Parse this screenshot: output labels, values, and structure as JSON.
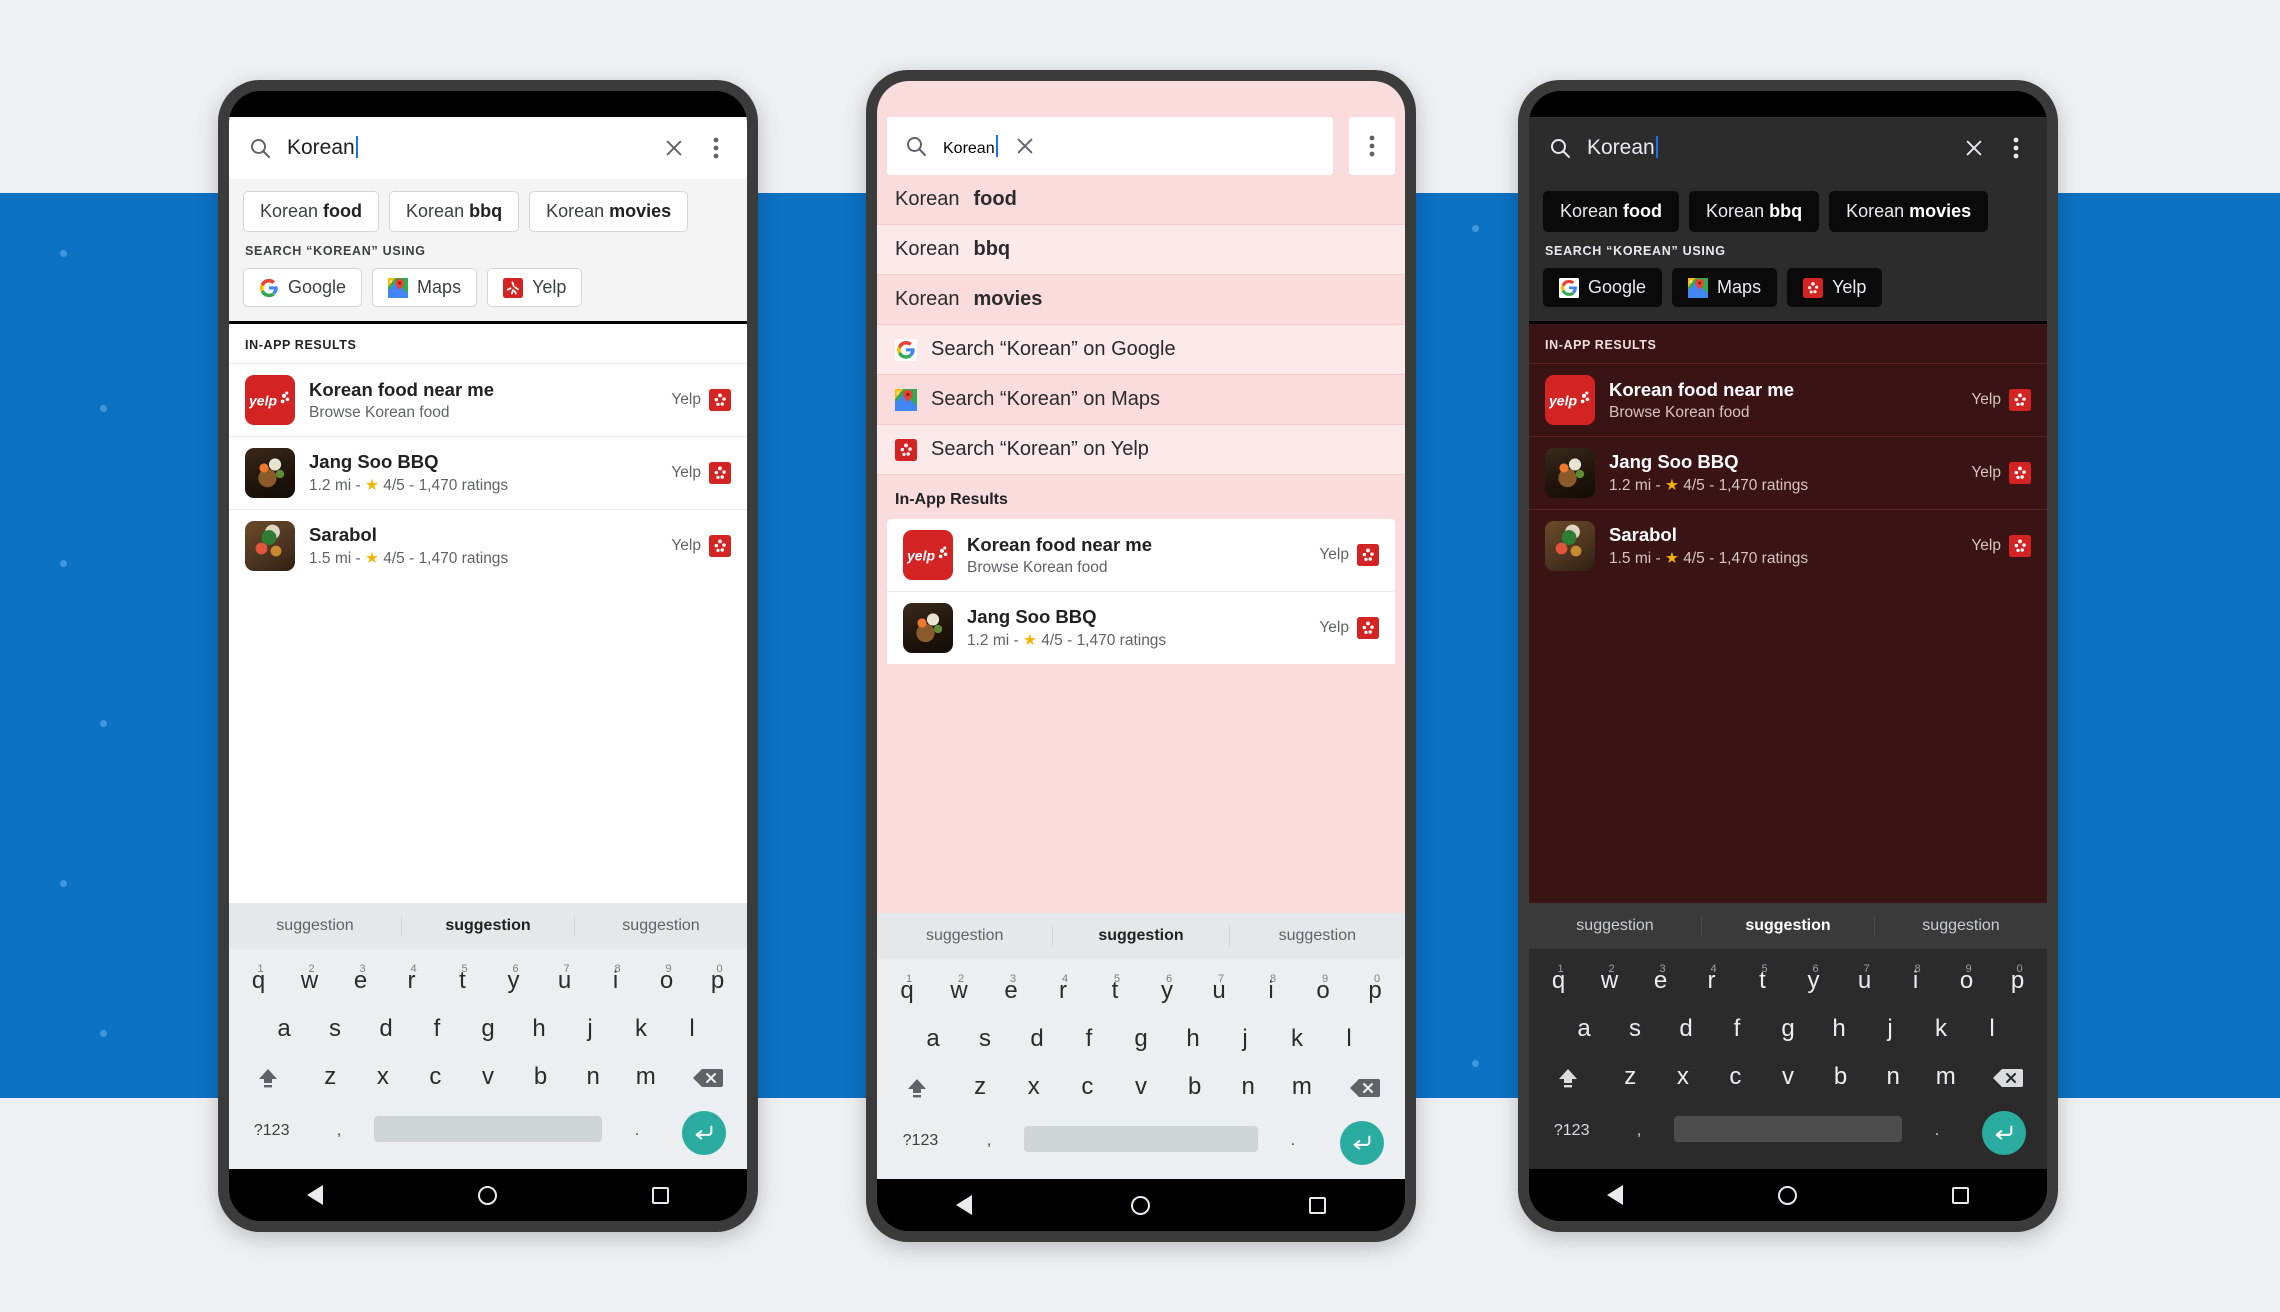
{
  "search": {
    "query": "Korean",
    "search_icon": "search-icon",
    "clear_icon": "close-icon",
    "overflow_icon": "kebab-menu-icon"
  },
  "chips": [
    {
      "prefix": "Korean ",
      "bold": "food"
    },
    {
      "prefix": "Korean ",
      "bold": "bbq"
    },
    {
      "prefix": "Korean ",
      "bold": "movies"
    }
  ],
  "engines_label": "SEARCH “KOREAN” USING",
  "engines": [
    {
      "label": "Google",
      "icon": "google-icon"
    },
    {
      "label": "Maps",
      "icon": "google-maps-icon"
    },
    {
      "label": "Yelp",
      "icon": "yelp-icon"
    }
  ],
  "results_label_caps": "IN-APP RESULTS",
  "results_label_title": "In-App Results",
  "results": [
    {
      "title": "Korean food near me",
      "subtitle": "Browse Korean food",
      "source": "Yelp",
      "thumb": "yelp-logo-tile",
      "has_rating": false
    },
    {
      "title": "Jang Soo BBQ",
      "distance": "1.2 mi",
      "separator": " - ",
      "star": "★",
      "rating": "4/5",
      "ratings_count": "1,470 ratings",
      "source": "Yelp",
      "thumb": "food-photo-bbq",
      "has_rating": true
    },
    {
      "title": "Sarabol",
      "distance": "1.5 mi",
      "separator": " - ",
      "star": "★",
      "rating": "4/5",
      "ratings_count": "1,470 ratings",
      "source": "Yelp",
      "thumb": "food-photo-sarabol",
      "has_rating": true
    }
  ],
  "pink_suggestions": [
    {
      "prefix": "Korean ",
      "bold": "food",
      "icon": null
    },
    {
      "prefix": "Korean ",
      "bold": "bbq",
      "icon": null
    },
    {
      "prefix": "Korean ",
      "bold": "movies",
      "icon": null
    },
    {
      "prefix": "Search “Korean” on Google",
      "bold": "",
      "icon": "google-icon"
    },
    {
      "prefix": "Search “Korean” on Maps",
      "bold": "",
      "icon": "google-maps-icon"
    },
    {
      "prefix": "Search “Korean” on Yelp",
      "bold": "",
      "icon": "yelp-icon"
    }
  ],
  "keyboard": {
    "suggestions": [
      "suggestion",
      "suggestion",
      "suggestion"
    ],
    "selected_index": 1,
    "row1": [
      {
        "k": "q",
        "n": "1"
      },
      {
        "k": "w",
        "n": "2"
      },
      {
        "k": "e",
        "n": "3"
      },
      {
        "k": "r",
        "n": "4"
      },
      {
        "k": "t",
        "n": "5"
      },
      {
        "k": "y",
        "n": "6"
      },
      {
        "k": "u",
        "n": "7"
      },
      {
        "k": "i",
        "n": "8"
      },
      {
        "k": "o",
        "n": "9"
      },
      {
        "k": "p",
        "n": "0"
      }
    ],
    "row2": [
      "a",
      "s",
      "d",
      "f",
      "g",
      "h",
      "j",
      "k",
      "l"
    ],
    "row3": [
      "z",
      "x",
      "c",
      "v",
      "b",
      "n",
      "m"
    ],
    "shift_icon": "shift-up-icon",
    "backspace_icon": "backspace-icon",
    "symbols_key": "?123",
    "comma_key": ",",
    "period_key": ".",
    "enter_icon": "enter-key-icon",
    "enter_color": "#2aada0"
  },
  "navbar": {
    "back_icon": "back-triangle-icon",
    "home_icon": "home-circle-icon",
    "recents_icon": "recents-square-icon"
  },
  "theme_colors": {
    "backdrop": "#eef0f3",
    "band": "#0b72c4",
    "pink_surface": "#fbdcdc",
    "dark_surface": "#2c2c2c",
    "dark_results": "#3a1414",
    "yelp_red": "#d32323",
    "star_yellow": "#f4b400"
  }
}
